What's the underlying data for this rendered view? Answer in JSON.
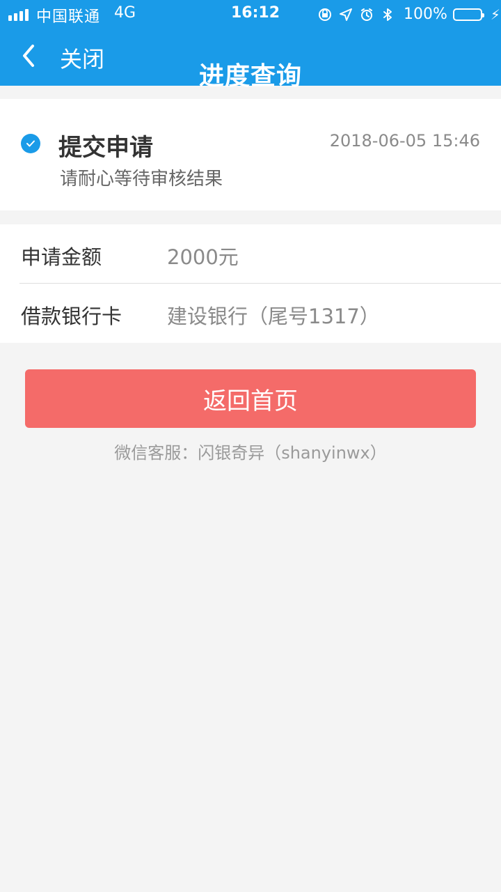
{
  "status_bar": {
    "carrier": "中国联通",
    "network": "4G",
    "time": "16:12",
    "battery_percent": "100%",
    "battery_level": 1.0,
    "icons": [
      "orientation-lock-icon",
      "location-icon",
      "alarm-icon",
      "bluetooth-icon",
      "battery-icon",
      "charging-icon"
    ]
  },
  "header": {
    "close_label": "关闭",
    "title": "进度查询"
  },
  "progress": {
    "step_title": "提交申请",
    "timestamp": "2018-06-05 15:46",
    "description": "请耐心等待审核结果"
  },
  "details": {
    "amount_label": "申请金额",
    "amount_value": "2000元",
    "bank_card_label": "借款银行卡",
    "bank_card_value": "建设银行（尾号1317）"
  },
  "actions": {
    "home_button_label": "返回首页"
  },
  "support": {
    "text": "微信客服：闪银奇异（shanyinwx）"
  },
  "colors": {
    "header": "#1a9be8",
    "primary_button": "#f46b69",
    "background": "#f4f4f4"
  }
}
